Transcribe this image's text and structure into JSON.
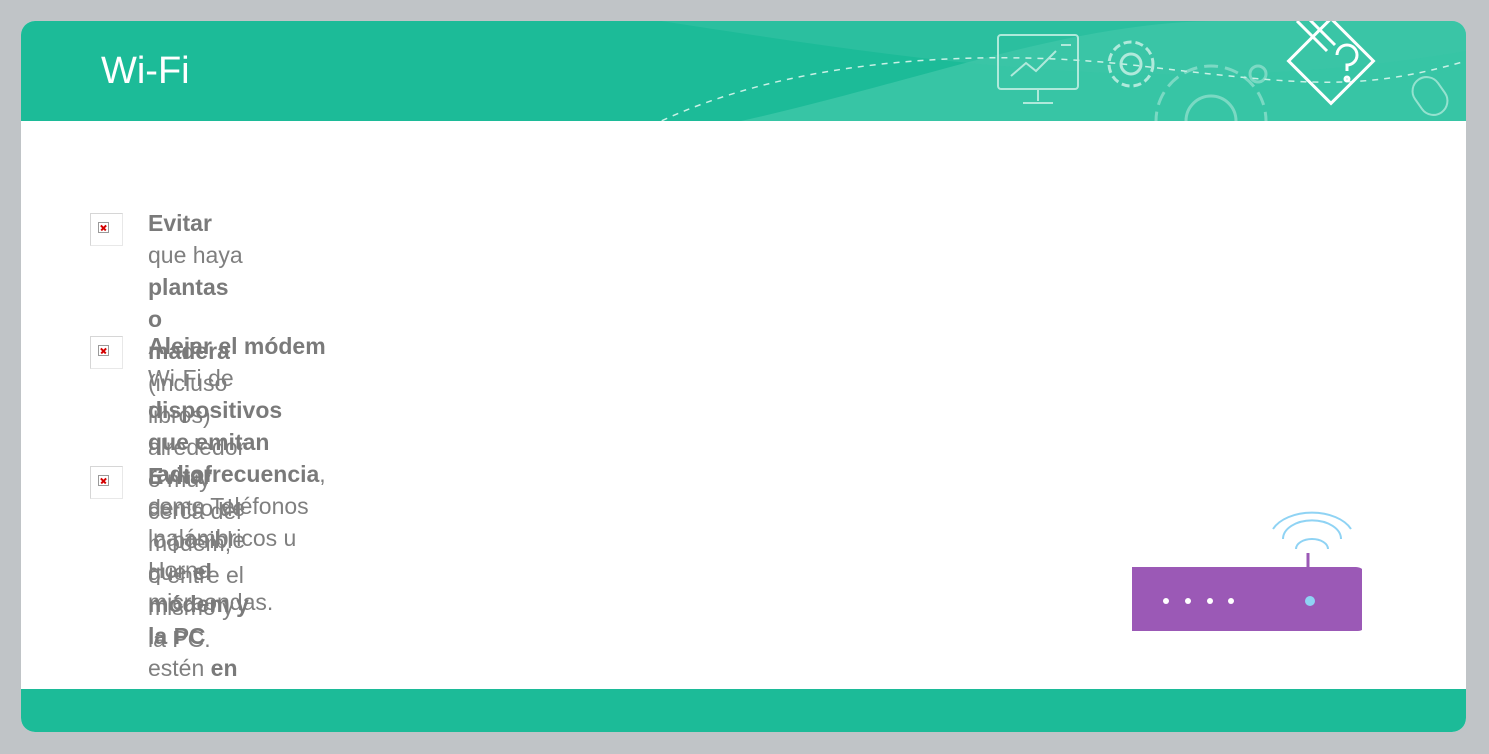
{
  "header": {
    "title": "Wi-Fi",
    "icons": [
      "presentation-screen-icon",
      "gear-icon",
      "large-gear-icon",
      "pencil-question-badge-icon",
      "mouse-icon"
    ]
  },
  "bullets": [
    {
      "icon": "broken-image-icon",
      "segments": [
        {
          "text": "Evitar",
          "bold": true
        },
        {
          "text": " que haya ",
          "bold": false
        },
        {
          "text": "plantas o madera",
          "bold": true
        },
        {
          "text": " (incluso libros) alrededor o muy cerca del módem, o entre el",
          "bold": false
        },
        {
          "br": true
        },
        {
          "text": "mismo y la PC.",
          "bold": false
        }
      ]
    },
    {
      "icon": "broken-image-icon",
      "segments": [
        {
          "text": "Alejar el módem",
          "bold": true
        },
        {
          "text": " Wi-Fi de ",
          "bold": false
        },
        {
          "text": "dispositivos que emitan radiofrecuencia",
          "bold": true
        },
        {
          "text": ", como Teléfonos",
          "bold": false
        },
        {
          "br": true
        },
        {
          "text": "inalámbricos u Horno microondas.",
          "bold": false
        }
      ]
    },
    {
      "icon": "broken-image-icon",
      "segments": [
        {
          "text": "Evitar",
          "bold": true
        },
        {
          "text": " dentro de lo posible que ",
          "bold": false
        },
        {
          "text": "el módem y la PC",
          "bold": true
        },
        {
          "text": " estén ",
          "bold": false
        },
        {
          "text": "en pisos diferentes",
          "bold": true
        },
        {
          "text": ".",
          "bold": false
        }
      ]
    }
  ],
  "router": {
    "icon": "wifi-router-icon",
    "body_color": "#9b59b6",
    "signal_color": "#8fd3f4"
  },
  "colors": {
    "accent": "#1cbb98",
    "background": "#c0c4c7",
    "text": "#7f7f7f"
  }
}
